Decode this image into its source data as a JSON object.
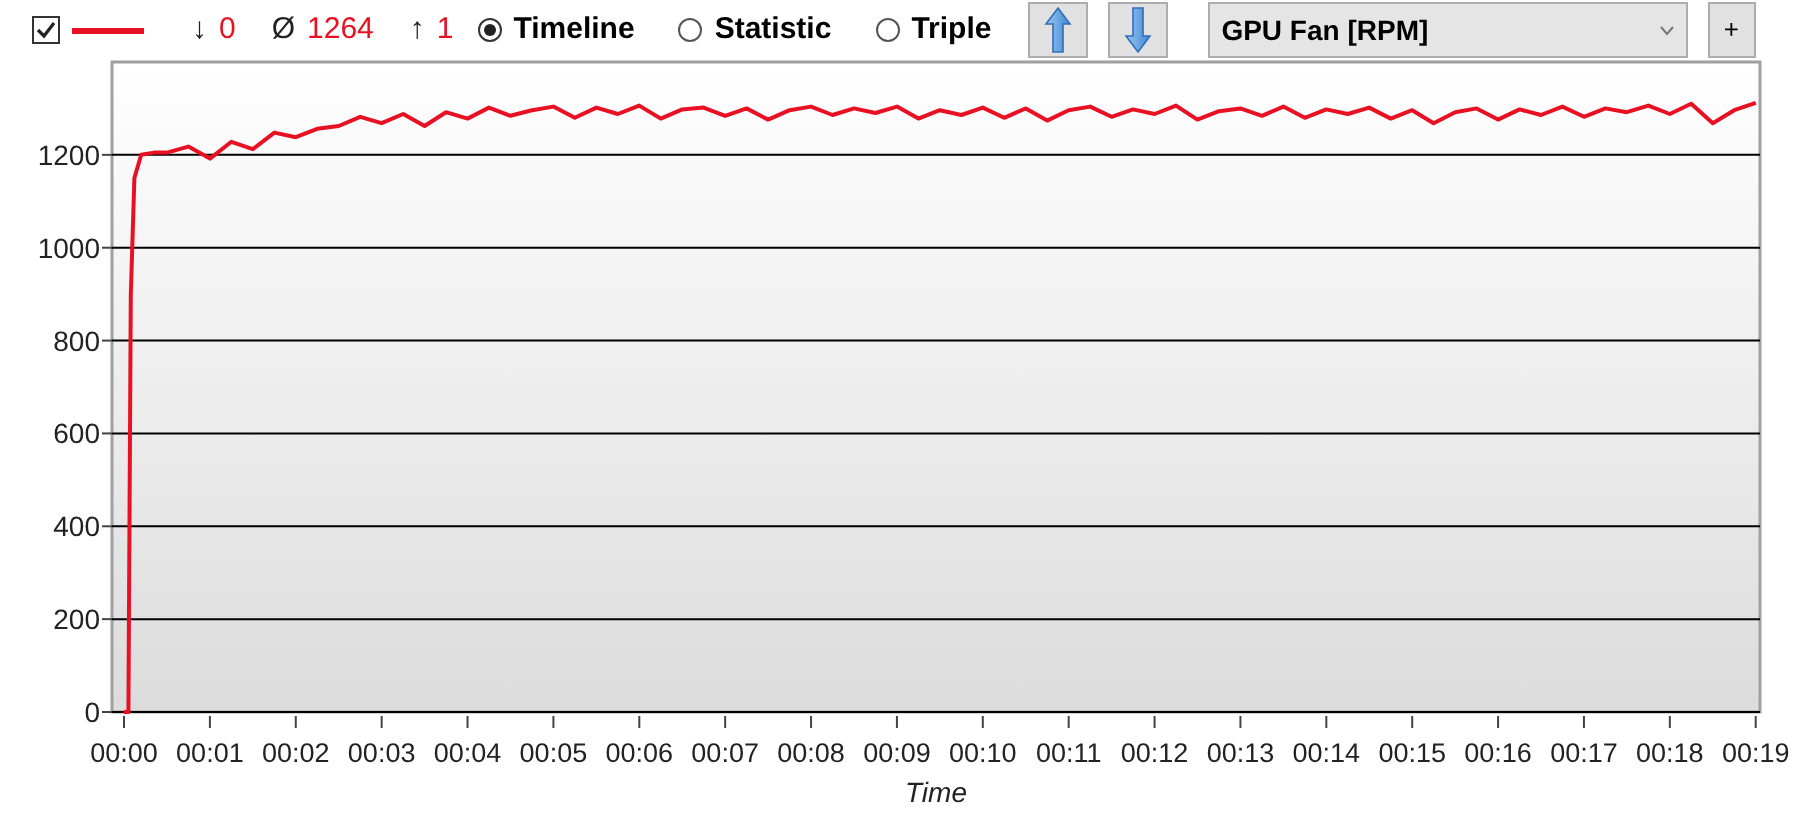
{
  "series_toggle": {
    "checked": true
  },
  "stats": [
    {
      "arrow": "↓",
      "value": "0"
    },
    {
      "arrow": "Ø",
      "value": "1264"
    },
    {
      "arrow": "↑",
      "value": "1"
    }
  ],
  "views": [
    {
      "label": "Timeline",
      "selected": true
    },
    {
      "label": "Statistic",
      "selected": false
    },
    {
      "label": "Triple",
      "selected": false
    }
  ],
  "add_button": "+",
  "chart": {
    "chart_data": {
      "type": "line",
      "grid": true,
      "xlabel": "Time",
      "xlim": [
        -0.14,
        19.05
      ],
      "ylim": [
        0,
        1400
      ],
      "x": [
        0,
        0.05,
        0.08,
        0.12,
        0.2,
        0.35,
        0.5,
        0.75,
        1,
        1.25,
        1.5,
        1.75,
        2,
        2.25,
        2.5,
        2.75,
        3,
        3.25,
        3.5,
        3.75,
        4,
        4.25,
        4.5,
        4.75,
        5,
        5.25,
        5.5,
        5.75,
        6,
        6.25,
        6.5,
        6.75,
        7,
        7.25,
        7.5,
        7.75,
        8,
        8.25,
        8.5,
        8.75,
        9,
        9.25,
        9.5,
        9.75,
        10,
        10.25,
        10.5,
        10.75,
        11,
        11.25,
        11.5,
        11.75,
        12,
        12.25,
        12.5,
        12.75,
        13,
        13.25,
        13.5,
        13.75,
        14,
        14.25,
        14.5,
        14.75,
        15,
        15.25,
        15.5,
        15.75,
        16,
        16.25,
        16.5,
        16.75,
        17,
        17.25,
        17.5,
        17.75,
        18,
        18.25,
        18.5,
        18.75,
        19
      ],
      "series": [
        {
          "name": "GPU Fan [RPM]",
          "color": "#e81123",
          "values": [
            0,
            0,
            900,
            1150,
            1200,
            1205,
            1205,
            1218,
            1192,
            1228,
            1212,
            1248,
            1238,
            1256,
            1262,
            1282,
            1268,
            1288,
            1262,
            1292,
            1278,
            1302,
            1284,
            1296,
            1304,
            1280,
            1302,
            1288,
            1306,
            1278,
            1298,
            1302,
            1284,
            1300,
            1276,
            1296,
            1304,
            1286,
            1300,
            1290,
            1304,
            1278,
            1296,
            1286,
            1302,
            1280,
            1300,
            1274,
            1296,
            1304,
            1282,
            1298,
            1288,
            1306,
            1276,
            1294,
            1300,
            1284,
            1304,
            1280,
            1298,
            1288,
            1302,
            1278,
            1296,
            1268,
            1292,
            1300,
            1276,
            1298,
            1286,
            1304,
            1282,
            1300,
            1292,
            1306,
            1288,
            1310,
            1268,
            1296,
            1312
          ]
        }
      ],
      "xticks": [
        {
          "value": 0,
          "label": "00:00"
        },
        {
          "value": 1,
          "label": "00:01"
        },
        {
          "value": 2,
          "label": "00:02"
        },
        {
          "value": 3,
          "label": "00:03"
        },
        {
          "value": 4,
          "label": "00:04"
        },
        {
          "value": 5,
          "label": "00:05"
        },
        {
          "value": 6,
          "label": "00:06"
        },
        {
          "value": 7,
          "label": "00:07"
        },
        {
          "value": 8,
          "label": "00:08"
        },
        {
          "value": 9,
          "label": "00:09"
        },
        {
          "value": 10,
          "label": "00:10"
        },
        {
          "value": 11,
          "label": "00:11"
        },
        {
          "value": 12,
          "label": "00:12"
        },
        {
          "value": 13,
          "label": "00:13"
        },
        {
          "value": 14,
          "label": "00:14"
        },
        {
          "value": 15,
          "label": "00:15"
        },
        {
          "value": 16,
          "label": "00:16"
        },
        {
          "value": 17,
          "label": "00:17"
        },
        {
          "value": 18,
          "label": "00:18"
        },
        {
          "value": 19,
          "label": "00:19"
        }
      ],
      "yticks": [
        0,
        200,
        400,
        600,
        800,
        1000,
        1200
      ]
    }
  }
}
